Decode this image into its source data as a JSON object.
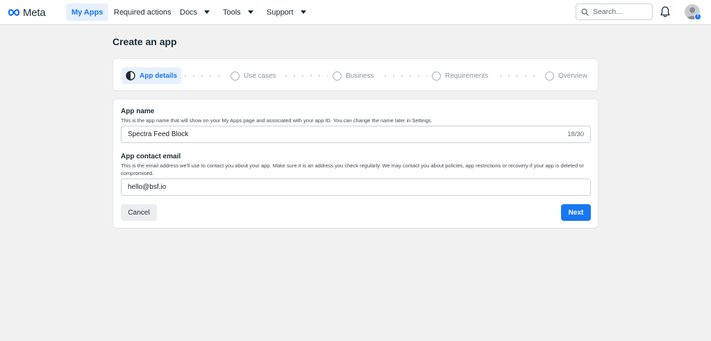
{
  "brand": {
    "logo_text": "Meta"
  },
  "nav": {
    "items": [
      {
        "label": "My Apps",
        "active": true,
        "dropdown": false
      },
      {
        "label": "Required actions",
        "active": false,
        "dropdown": false
      },
      {
        "label": "Docs",
        "active": false,
        "dropdown": true
      },
      {
        "label": "Tools",
        "active": false,
        "dropdown": true
      },
      {
        "label": "Support",
        "active": false,
        "dropdown": true
      }
    ],
    "search_placeholder": "Search..."
  },
  "page": {
    "title": "Create an app"
  },
  "stepper": {
    "steps": [
      {
        "label": "App details",
        "active": true
      },
      {
        "label": "Use cases",
        "active": false
      },
      {
        "label": "Business",
        "active": false
      },
      {
        "label": "Requirements",
        "active": false
      },
      {
        "label": "Overview",
        "active": false
      }
    ]
  },
  "form": {
    "app_name": {
      "label": "App name",
      "help": "This is the app name that will show on your My Apps page and associated with your app ID. You can change the name later in Settings.",
      "value": "Spectra Feed Block",
      "counter": "18/30"
    },
    "contact_email": {
      "label": "App contact email",
      "help": "This is the email address we'll use to contact you about your app. Make sure it is an address you check regularly. We may contact you about policies, app restrictions or recovery if your app is deleted or compromised.",
      "value": "hello@bsf.io"
    },
    "cancel_label": "Cancel",
    "next_label": "Next"
  },
  "colors": {
    "accent": "#1877f2",
    "accent_bg": "#e7f0fd",
    "page_bg": "#f1f1f1"
  }
}
